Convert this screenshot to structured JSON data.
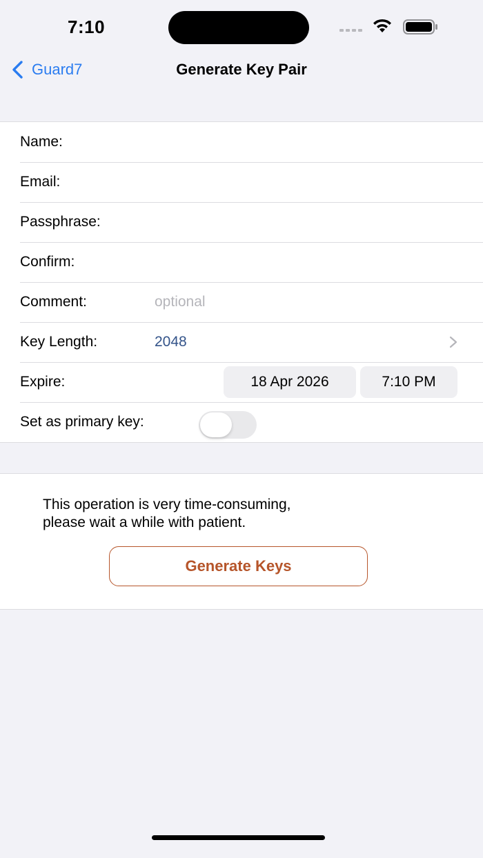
{
  "status_bar": {
    "time": "7:10"
  },
  "nav": {
    "back_label": "Guard7",
    "title": "Generate Key Pair"
  },
  "form": {
    "name_label": "Name:",
    "email_label": "Email:",
    "passphrase_label": "Passphrase:",
    "confirm_label": "Confirm:",
    "comment_label": "Comment:",
    "comment_placeholder": "optional",
    "key_length_label": "Key Length:",
    "key_length_value": "2048",
    "expire_label": "Expire:",
    "expire_date": "18 Apr 2026",
    "expire_time": "7:10 PM",
    "primary_label": "Set as primary key:",
    "primary_on": false
  },
  "info": {
    "text_line1": "This operation is very time-consuming,",
    "text_line2": "please wait a while with patient.",
    "button_label": "Generate Keys"
  },
  "colors": {
    "accent_blue": "#2a7cf0",
    "value_blue": "#34548a",
    "button_orange": "#b6552a",
    "background": "#f2f2f7"
  }
}
